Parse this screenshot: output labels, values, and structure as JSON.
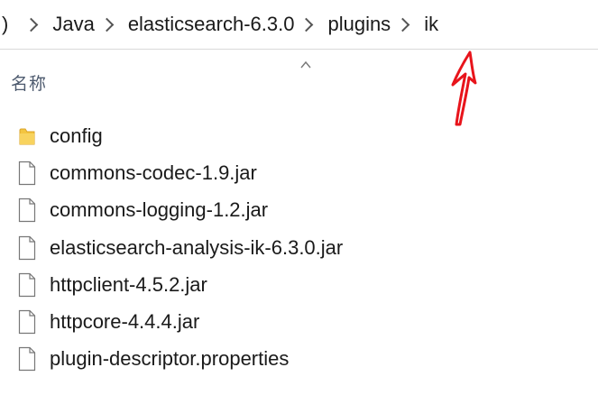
{
  "breadcrumb": {
    "leading": ")",
    "items": [
      {
        "label": "Java"
      },
      {
        "label": "elasticsearch-6.3.0"
      },
      {
        "label": "plugins"
      },
      {
        "label": "ik"
      }
    ]
  },
  "columns": {
    "name_header": "名称",
    "sort_icon": "chevron-up-icon"
  },
  "annotation": {
    "icon": "red-arrow-icon",
    "color": "#e8141b"
  },
  "files": [
    {
      "name": "config",
      "type": "folder",
      "icon": "folder-icon"
    },
    {
      "name": "commons-codec-1.9.jar",
      "type": "file",
      "icon": "file-icon"
    },
    {
      "name": "commons-logging-1.2.jar",
      "type": "file",
      "icon": "file-icon"
    },
    {
      "name": "elasticsearch-analysis-ik-6.3.0.jar",
      "type": "file",
      "icon": "file-icon"
    },
    {
      "name": "httpclient-4.5.2.jar",
      "type": "file",
      "icon": "file-icon"
    },
    {
      "name": "httpcore-4.4.4.jar",
      "type": "file",
      "icon": "file-icon"
    },
    {
      "name": "plugin-descriptor.properties",
      "type": "file",
      "icon": "file-icon"
    }
  ],
  "colors": {
    "folder": "#f3c540",
    "folder_dark": "#dba42a",
    "text": "#1a1a1a",
    "header_text": "#4d5a6e"
  }
}
